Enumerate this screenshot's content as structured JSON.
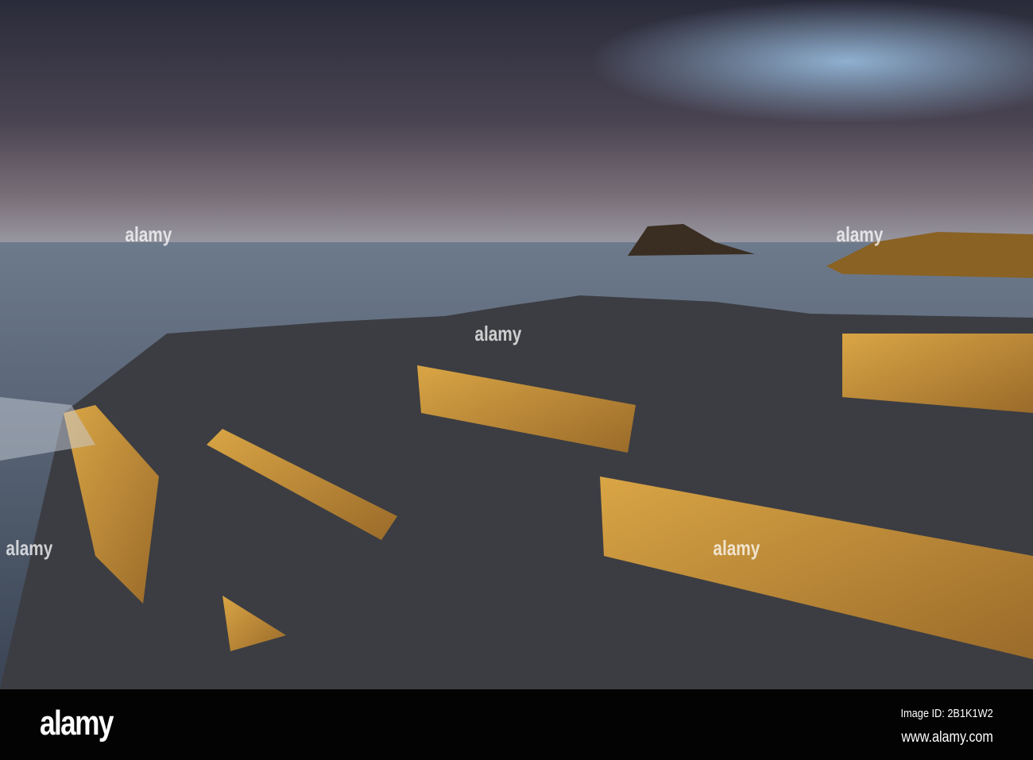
{
  "photo": {
    "subject": "coastal rock shelves at sunset"
  },
  "watermark": {
    "text": "alamy"
  },
  "footer": {
    "logo": "alamy",
    "image_id": "Image ID: 2B1K1W2",
    "website": "www.alamy.com"
  }
}
